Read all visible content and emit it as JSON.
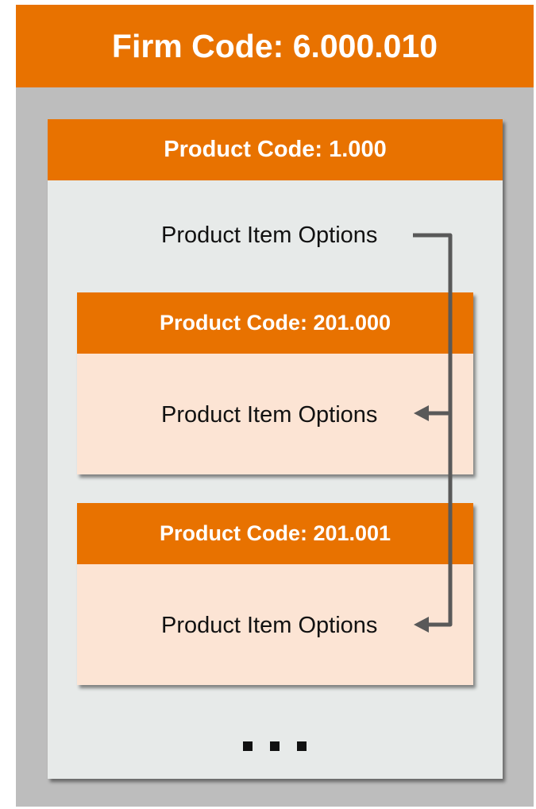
{
  "firm": {
    "title": "Firm Code: 6.000.010"
  },
  "product": {
    "title": "Product Code: 1.000",
    "options_label": "Product Item Options"
  },
  "sub_products": [
    {
      "title": "Product Code: 201.000",
      "options_label": "Product Item Options"
    },
    {
      "title": "Product Code: 201.001",
      "options_label": "Product Item Options"
    }
  ],
  "ellipsis": "...",
  "colors": {
    "header_orange": "#e87200",
    "outer_gray": "#bdbdbd",
    "panel_gray": "#e7eae9",
    "card_peach": "#fce4d4",
    "arrow_gray": "#595959"
  }
}
